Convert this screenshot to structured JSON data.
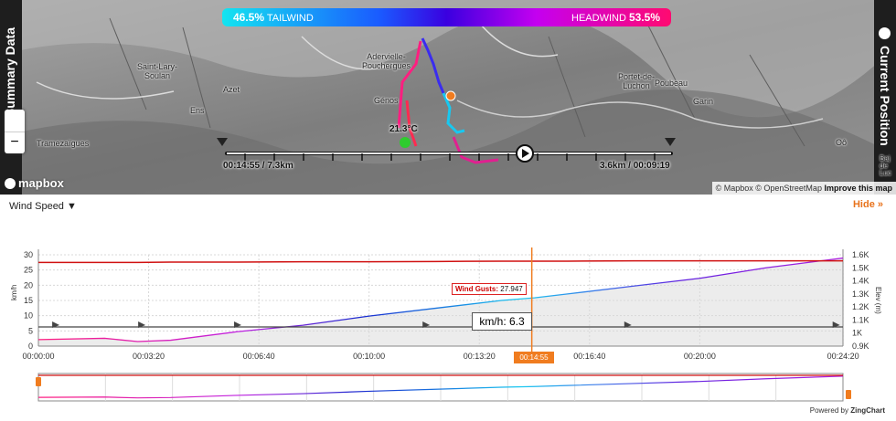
{
  "map": {
    "summary_tab": "Summary Data",
    "position_tab": "Current Position",
    "tailwind": {
      "percent": "46.5%",
      "label": "TAILWIND"
    },
    "headwind": {
      "label": "HEADWIND",
      "percent": "53.5%"
    },
    "places": [
      {
        "name": "Saint-Lary-\nSoulan"
      },
      {
        "name": "Azet"
      },
      {
        "name": "Ens"
      },
      {
        "name": "Tramezaïgues"
      },
      {
        "name": "Adervielle-\nPouchergues"
      },
      {
        "name": "Génos"
      },
      {
        "name": "Portet-de-\nLuchon"
      },
      {
        "name": "Poubeau"
      },
      {
        "name": "Garin"
      },
      {
        "name": "Oô"
      },
      {
        "name": "Baj\nde\nLuc"
      }
    ],
    "temperature": "21.3°C",
    "timeline": {
      "left": "00:14:55 / 7.3km",
      "right": "3.6km / 00:09:19"
    },
    "zoom_out": "−",
    "logo": "mapbox",
    "attribution": {
      "text": "© Mapbox © OpenStreetMap",
      "link": "Improve this map"
    }
  },
  "chart": {
    "selector": "Wind Speed ▼",
    "hide": "Hide »",
    "tooltip": "km/h: 6.3",
    "gust_label": "Wind Gusts:",
    "gust_value": "27.947",
    "current_time": "00:14:55",
    "powered_prefix": "Powered by",
    "powered_brand": "ZingChart"
  },
  "chart_data": {
    "type": "line",
    "title": "",
    "xlabel": "",
    "ylabel": "km/h",
    "y2label": "Elev (m)",
    "ylim": [
      0,
      30
    ],
    "y2lim": [
      900,
      1600
    ],
    "xticks": [
      "00:00:00",
      "00:03:20",
      "00:06:40",
      "00:10:00",
      "00:13:20",
      "00:16:40",
      "00:20:00",
      "00:24:20"
    ],
    "yticks": [
      "0",
      "5",
      "10",
      "15",
      "20",
      "25",
      "30"
    ],
    "y2ticks": [
      "0.9K",
      "1K",
      "1.1K",
      "1.2K",
      "1.3K",
      "1.4K",
      "1.5K",
      "1.6K"
    ],
    "x_minutes": [
      0,
      2,
      3,
      4,
      6,
      8,
      10,
      12,
      14,
      15,
      16,
      18,
      20,
      22,
      24.33
    ],
    "series": [
      {
        "name": "Wind Gusts",
        "color": "#d01010",
        "values": [
          27.5,
          27.5,
          27.5,
          27.6,
          27.6,
          27.7,
          27.7,
          27.8,
          27.9,
          27.9,
          27.9,
          28.0,
          28.0,
          28.0,
          28.0
        ]
      },
      {
        "color": "#444444",
        "values": [
          6.3,
          6.3,
          6.3,
          6.3,
          6.3,
          6.3,
          6.3,
          6.3,
          6.3,
          6.3,
          6.3,
          6.3,
          6.3,
          6.3,
          6.3
        ]
      }
    ],
    "elevation_m": [
      950,
      960,
      935,
      945,
      1010,
      1060,
      1130,
      1190,
      1250,
      1270,
      1300,
      1360,
      1420,
      1500,
      1575
    ]
  }
}
